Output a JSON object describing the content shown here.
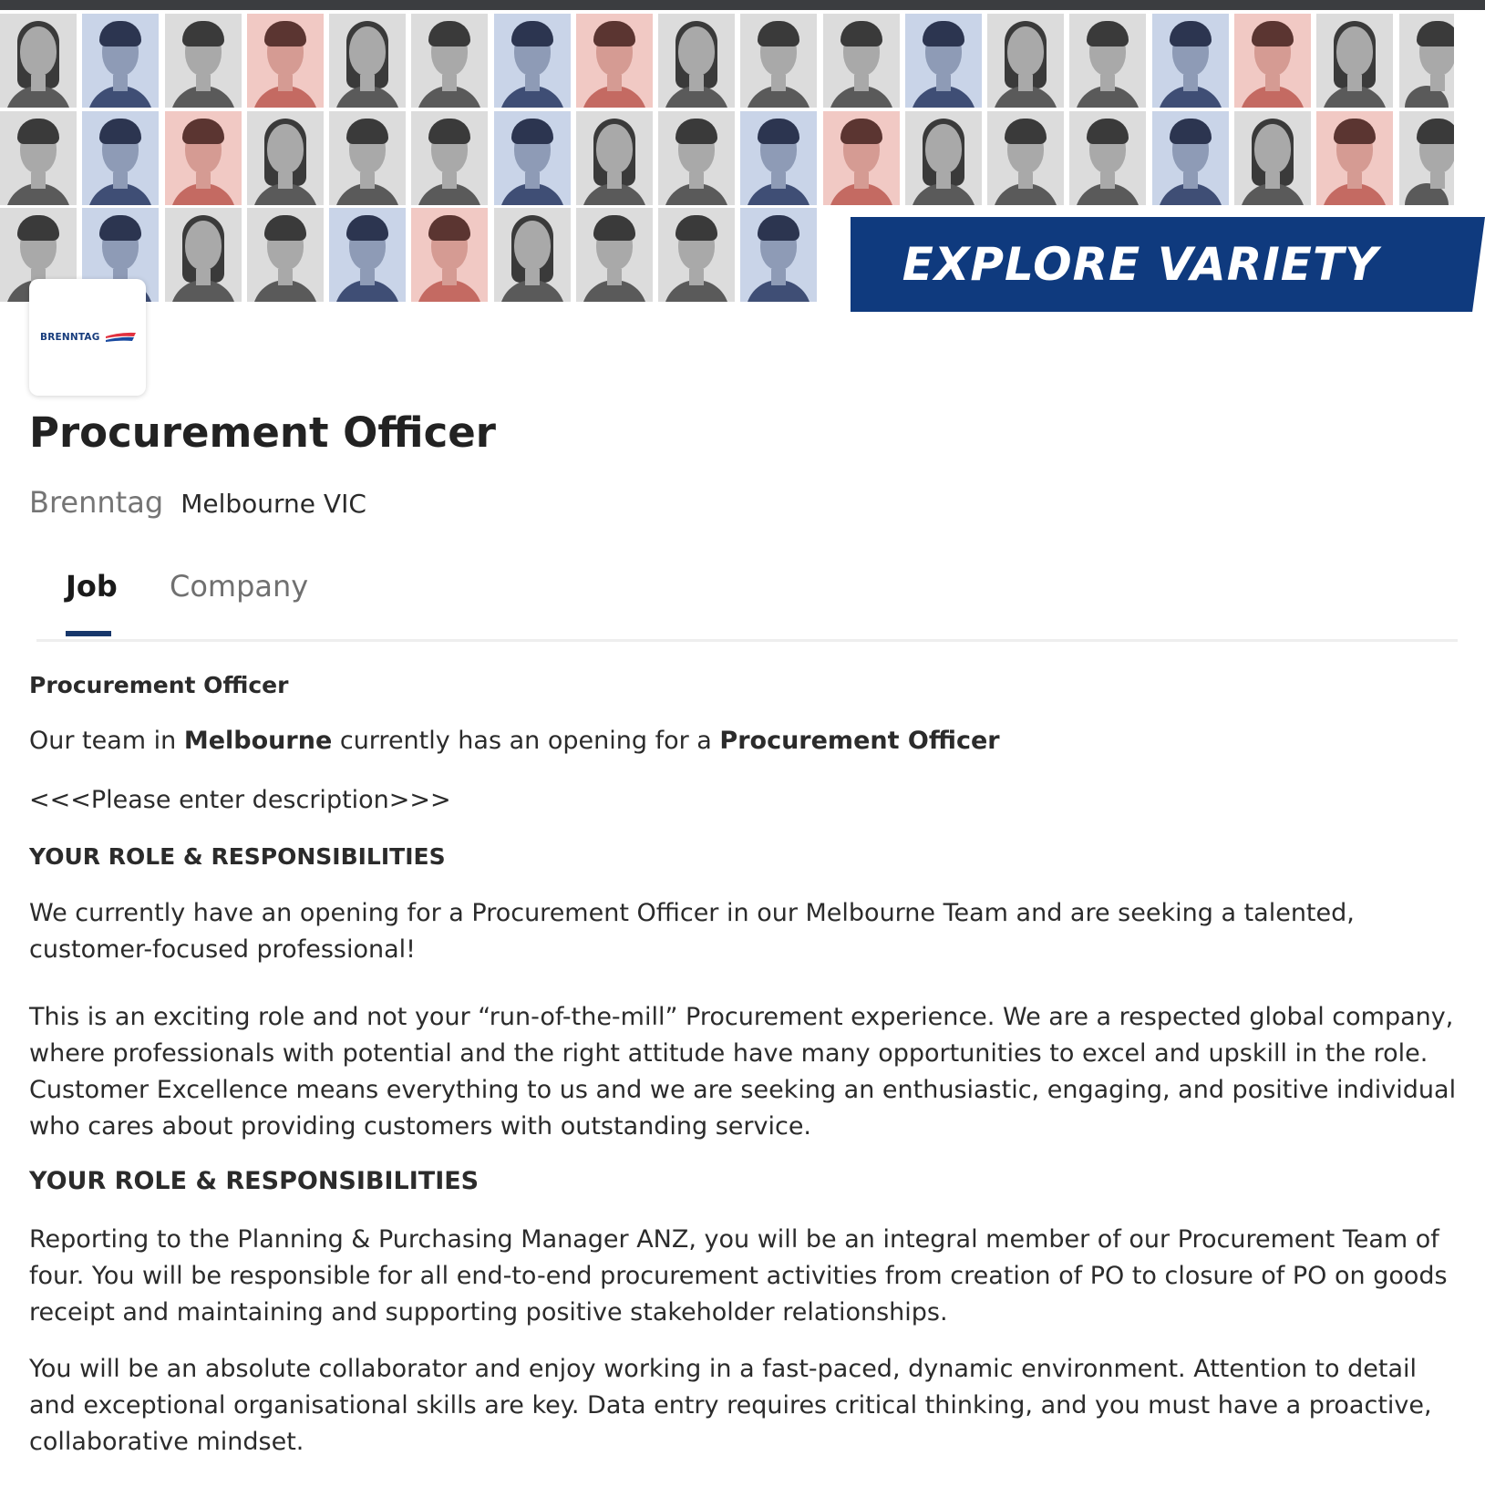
{
  "banner": {
    "headline": "EXPLORE VARIETY",
    "brand_color": "#0f3a7e",
    "photo_count": 47
  },
  "company": {
    "logo_text": "BRENNTAG",
    "name": "Brenntag",
    "location": "Melbourne VIC"
  },
  "job": {
    "title": "Procurement Officer"
  },
  "tabs": [
    {
      "label": "Job",
      "active": true
    },
    {
      "label": "Company",
      "active": false
    }
  ],
  "description": {
    "heading": "Procurement Officer",
    "intro_prefix": "Our team in ",
    "intro_city": "Melbourne",
    "intro_middle": " currently has an opening for a ",
    "intro_role": "Procurement Officer",
    "placeholder": "<<<Please enter description>>>",
    "section1_heading": "YOUR ROLE & RESPONSIBILITIES",
    "paragraph1": "We currently have an opening for a Procurement Officer in our Melbourne Team and are seeking a talented, customer-focused professional!",
    "paragraph2": "This is an exciting role and not your “run-of-the-mill” Procurement experience. We are a respected global company, where professionals with potential and the right attitude have many opportunities to excel and upskill in the role. Customer Excellence means everything to us and we are seeking an enthusiastic, engaging, and positive individual who cares about providing customers with outstanding service.",
    "section2_heading": "YOUR ROLE & RESPONSIBILITIES",
    "paragraph3": "Reporting to the Planning & Purchasing Manager ANZ, you will be an integral member of our Procurement Team of four. You will be responsible for all end-to-end procurement activities from creation of PO to closure of PO on goods receipt and maintaining and supporting positive stakeholder relationships.",
    "paragraph4": "You will be an absolute collaborator and enjoy working in a fast-paced, dynamic environment. Attention to detail and exceptional organisational skills are key. Data entry requires critical thinking, and you must have a proactive, collaborative mindset."
  }
}
